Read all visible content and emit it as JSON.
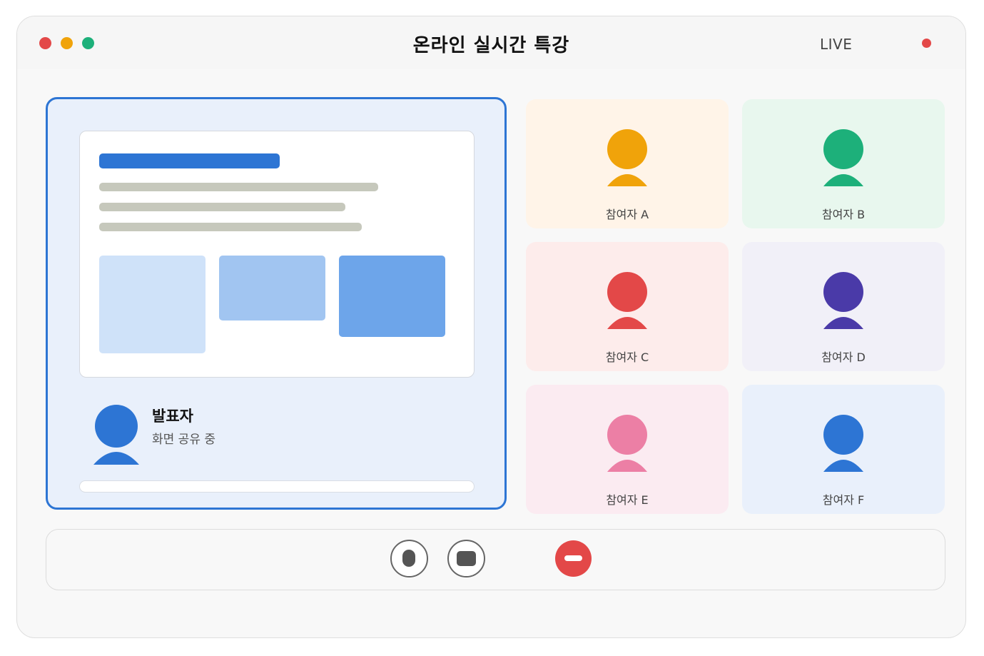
{
  "window": {
    "title": "온라인 실시간 특강",
    "live_label": "LIVE",
    "traffic_lights": [
      {
        "name": "close",
        "color": "#e34848"
      },
      {
        "name": "minimize",
        "color": "#f0a30a"
      },
      {
        "name": "maximize",
        "color": "#1db07a"
      }
    ]
  },
  "presenter": {
    "name": "발표자",
    "status": "화면 공유 중",
    "avatar_color": "#2d75d4",
    "accent_color": "#2d75d4"
  },
  "participants": [
    {
      "name": "참여자 A",
      "avatar_color": "#f0a30a",
      "tile_color": "#fff4e8"
    },
    {
      "name": "참여자 B",
      "avatar_color": "#1db07a",
      "tile_color": "#e8f7ee"
    },
    {
      "name": "참여자 C",
      "avatar_color": "#e34848",
      "tile_color": "#fdeceb"
    },
    {
      "name": "참여자 D",
      "avatar_color": "#4a3aa8",
      "tile_color": "#f1f0f8"
    },
    {
      "name": "참여자 E",
      "avatar_color": "#ec7fa5",
      "tile_color": "#fbebf1"
    },
    {
      "name": "참여자 F",
      "avatar_color": "#2d75d4",
      "tile_color": "#e9f0fb"
    }
  ],
  "controls": {
    "mic": {
      "icon": "microphone-icon"
    },
    "camera": {
      "icon": "camera-icon"
    },
    "leave": {
      "icon": "end-call-icon",
      "color": "#e34848"
    }
  }
}
